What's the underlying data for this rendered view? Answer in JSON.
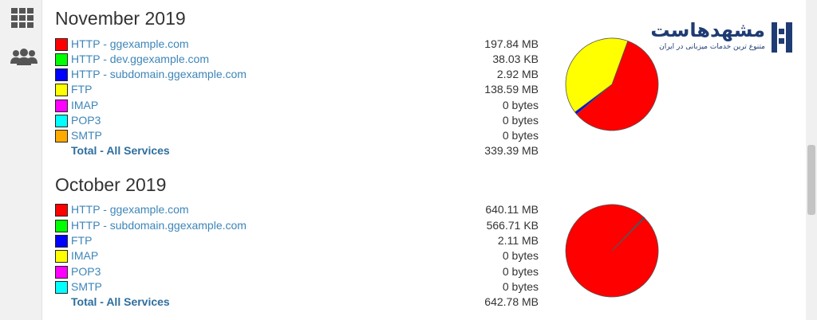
{
  "sidebar": {
    "icons": [
      "grid-icon",
      "users-icon"
    ]
  },
  "logo": {
    "text": "مشهدهاست",
    "tagline": "متنوع ترین خدمات میزبانی در ایران"
  },
  "months": [
    {
      "title": "November 2019",
      "services": [
        {
          "name": "HTTP - ggexample.com",
          "value": "197.84 MB",
          "color": "#ff0000"
        },
        {
          "name": "HTTP - dev.ggexample.com",
          "value": "38.03 KB",
          "color": "#00ff00"
        },
        {
          "name": "HTTP - subdomain.ggexample.com",
          "value": "2.92 MB",
          "color": "#0000ff"
        },
        {
          "name": "FTP",
          "value": "138.59 MB",
          "color": "#ffff00"
        },
        {
          "name": "IMAP",
          "value": "0 bytes",
          "color": "#ff00ff"
        },
        {
          "name": "POP3",
          "value": "0 bytes",
          "color": "#00ffff"
        },
        {
          "name": "SMTP",
          "value": "0 bytes",
          "color": "#ffaa00"
        }
      ],
      "total_label": "Total - All Services",
      "total_value": "339.39 MB",
      "pie": [
        {
          "label": "HTTP - ggexample.com",
          "fraction": 0.583,
          "color": "#ff0000"
        },
        {
          "label": "HTTP - subdomain.ggexample.com",
          "fraction": 0.009,
          "color": "#0000ff"
        },
        {
          "label": "FTP",
          "fraction": 0.408,
          "color": "#ffff00"
        }
      ]
    },
    {
      "title": "October 2019",
      "services": [
        {
          "name": "HTTP - ggexample.com",
          "value": "640.11 MB",
          "color": "#ff0000"
        },
        {
          "name": "HTTP - subdomain.ggexample.com",
          "value": "566.71 KB",
          "color": "#00ff00"
        },
        {
          "name": "FTP",
          "value": "2.11 MB",
          "color": "#0000ff"
        },
        {
          "name": "IMAP",
          "value": "0 bytes",
          "color": "#ffff00"
        },
        {
          "name": "POP3",
          "value": "0 bytes",
          "color": "#ff00ff"
        },
        {
          "name": "SMTP",
          "value": "0 bytes",
          "color": "#00ffff"
        }
      ],
      "total_label": "Total - All Services",
      "total_value": "642.78 MB",
      "pie": [
        {
          "label": "HTTP - ggexample.com",
          "fraction": 0.996,
          "color": "#ff0000"
        },
        {
          "label": "FTP",
          "fraction": 0.003,
          "color": "#0000ff"
        },
        {
          "label": "HTTP - subdomain.ggexample.com",
          "fraction": 0.001,
          "color": "#00ff00"
        }
      ]
    }
  ]
}
